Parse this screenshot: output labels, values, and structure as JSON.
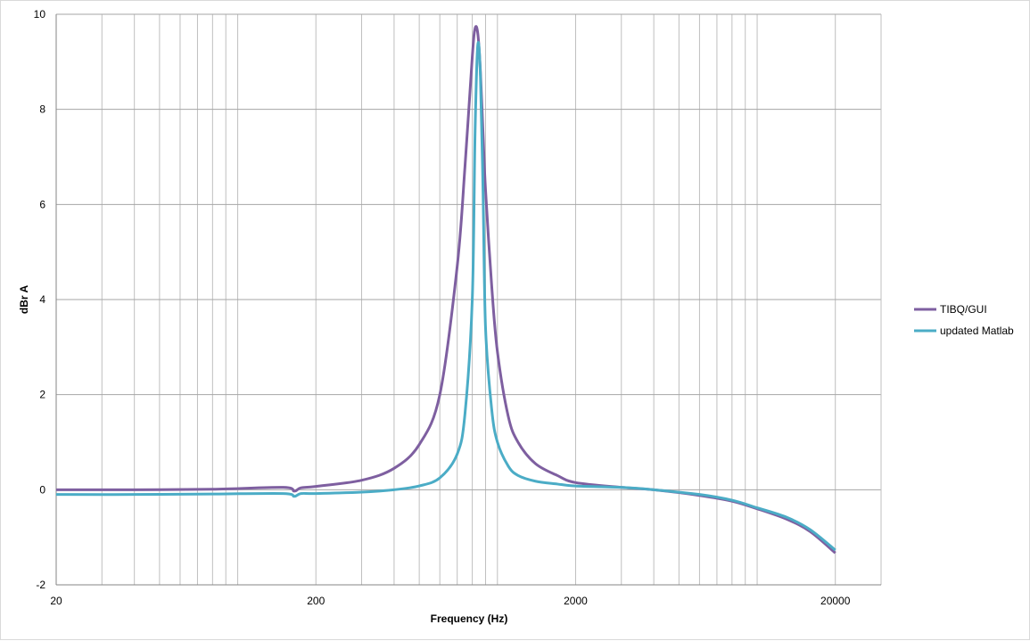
{
  "chart_data": {
    "type": "line",
    "title": "",
    "xlabel": "Frequency (Hz)",
    "ylabel": "dBr A",
    "xscale": "log",
    "xlim": [
      20,
      30000
    ],
    "ylim": [
      -2,
      10
    ],
    "xticks": [
      20,
      200,
      2000,
      20000
    ],
    "yticks": [
      -2,
      0,
      2,
      4,
      6,
      8,
      10
    ],
    "grid": true,
    "legend": "right",
    "series": [
      {
        "name": "TIBQ/GUI",
        "color": "#7E5FA0",
        "x": [
          20,
          40,
          80,
          150,
          165,
          175,
          200,
          300,
          400,
          500,
          600,
          700,
          750,
          800,
          820,
          840,
          860,
          880,
          900,
          950,
          1000,
          1100,
          1200,
          1400,
          1700,
          2000,
          3000,
          4000,
          6000,
          8000,
          10000,
          13000,
          16000,
          20000
        ],
        "y": [
          0.0,
          0.0,
          0.01,
          0.05,
          -0.03,
          0.04,
          0.07,
          0.2,
          0.45,
          0.95,
          2.0,
          4.7,
          6.8,
          9.1,
          9.7,
          9.6,
          8.8,
          7.5,
          6.3,
          4.3,
          2.9,
          1.55,
          1.0,
          0.55,
          0.3,
          0.15,
          0.05,
          0.0,
          -0.12,
          -0.24,
          -0.4,
          -0.62,
          -0.88,
          -1.33
        ]
      },
      {
        "name": "updated Matlab",
        "color": "#4BACC6",
        "x": [
          20,
          40,
          80,
          150,
          165,
          175,
          200,
          300,
          400,
          500,
          600,
          700,
          750,
          800,
          820,
          840,
          860,
          880,
          900,
          950,
          1000,
          1100,
          1200,
          1400,
          1700,
          2000,
          3000,
          4000,
          6000,
          8000,
          10000,
          13000,
          16000,
          20000
        ],
        "y": [
          -0.1,
          -0.1,
          -0.09,
          -0.08,
          -0.14,
          -0.08,
          -0.08,
          -0.05,
          0.0,
          0.08,
          0.25,
          0.75,
          1.6,
          4.0,
          7.5,
          9.35,
          8.7,
          6.3,
          3.4,
          1.7,
          1.0,
          0.5,
          0.3,
          0.18,
          0.12,
          0.08,
          0.05,
          0.0,
          -0.1,
          -0.22,
          -0.38,
          -0.58,
          -0.84,
          -1.27
        ]
      }
    ]
  }
}
